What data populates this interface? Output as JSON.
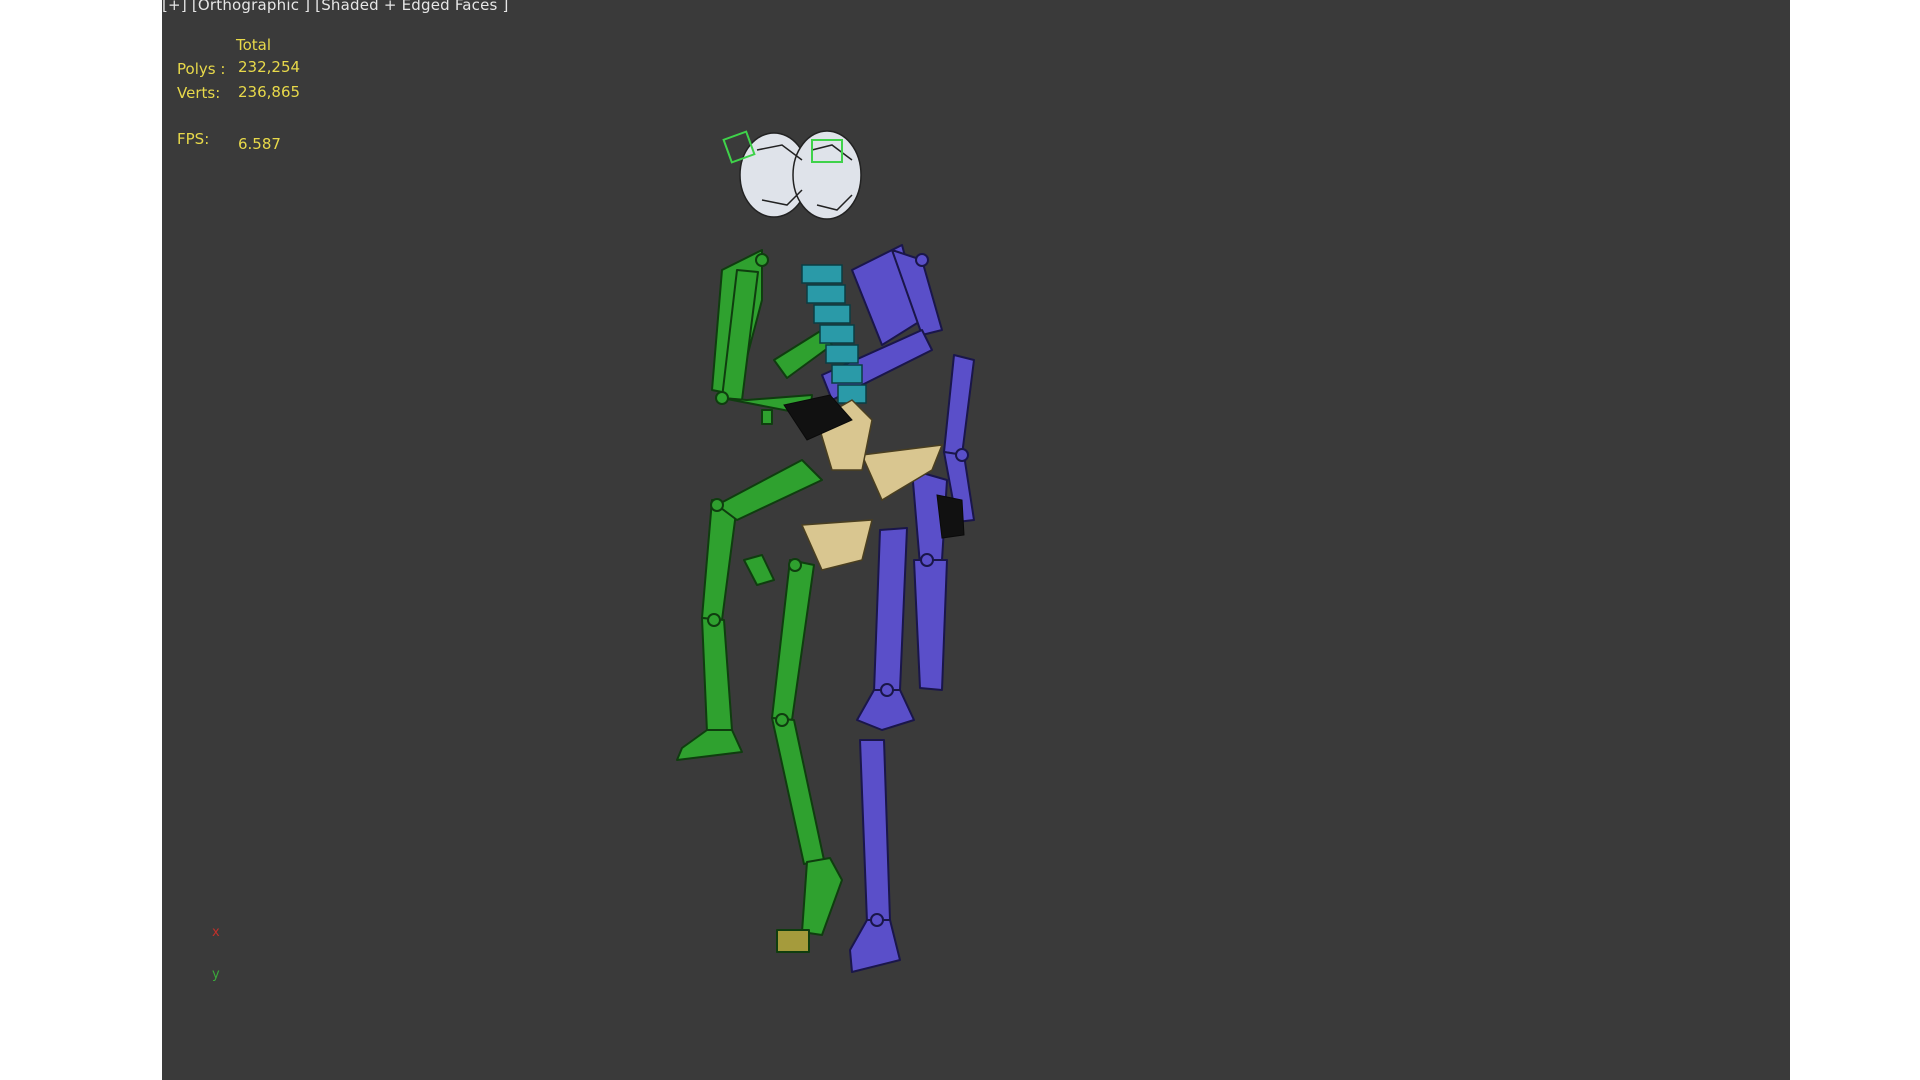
{
  "viewport": {
    "label": "[+] [Orthographic ] [Shaded + Edged Faces ]"
  },
  "stats": {
    "total_header": "Total",
    "polys_label": "Polys :",
    "polys_value": "232,254",
    "verts_label": "Verts:",
    "verts_value": "236,865",
    "fps_label": "FPS:",
    "fps_value": "6.587"
  },
  "axis": {
    "x_label": "x",
    "y_label": "y"
  },
  "colors": {
    "viewport_bg": "#3a3a3a",
    "stats_text": "#e8d94a",
    "biped_green": "#2fa12f",
    "biped_blue": "#5a4fc9",
    "pelvis_tan": "#d9c690",
    "head_grey": "#dfe3ea",
    "spine_teal": "#2a9aa8"
  },
  "icons": [
    "biped-green-icon",
    "biped-blue-icon",
    "axis-tripod-icon"
  ]
}
